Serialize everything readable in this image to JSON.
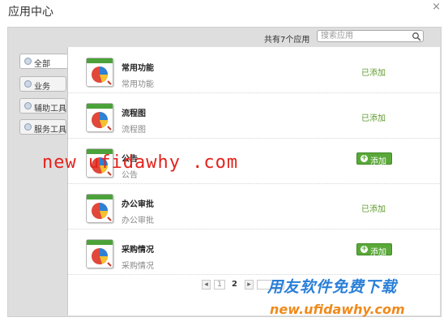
{
  "window": {
    "title": "应用中心",
    "close_glyph": "×"
  },
  "toolbar": {
    "count_text": "共有7个应用",
    "search": {
      "placeholder": "搜索应用",
      "value": ""
    }
  },
  "sidebar": {
    "items": [
      {
        "label": "全部",
        "active": true
      },
      {
        "label": "业务",
        "active": false
      },
      {
        "label": "辅助工具",
        "active": false
      },
      {
        "label": "服务工具",
        "active": false
      }
    ]
  },
  "apps": [
    {
      "name": "常用功能",
      "desc": "常用功能",
      "status": "已添加"
    },
    {
      "name": "流程图",
      "desc": "流程图",
      "status": "已添加"
    },
    {
      "name": "公告",
      "desc": "公告",
      "button": "添加"
    },
    {
      "name": "办公审批",
      "desc": "办公审批",
      "status": "已添加"
    },
    {
      "name": "采购情况",
      "desc": "采购情况",
      "button": "添加"
    }
  ],
  "pagination": {
    "pages": [
      "1",
      "2"
    ],
    "current": "2"
  },
  "watermark": {
    "main": "new ufidawhy .com",
    "cn": "用友软件免费下载",
    "url": "new.ufidawhy.com"
  },
  "colors": {
    "added": "#5f9a2e",
    "add_button": "#5aa83a",
    "watermark_red": "#e3221d",
    "watermark_blue": "#2a7fd8",
    "watermark_orange": "#f08a1c"
  },
  "icons": [
    "search-icon",
    "close-icon",
    "category-icon",
    "app-chart-icon",
    "plus-icon",
    "prev-page-icon",
    "next-page-icon"
  ]
}
